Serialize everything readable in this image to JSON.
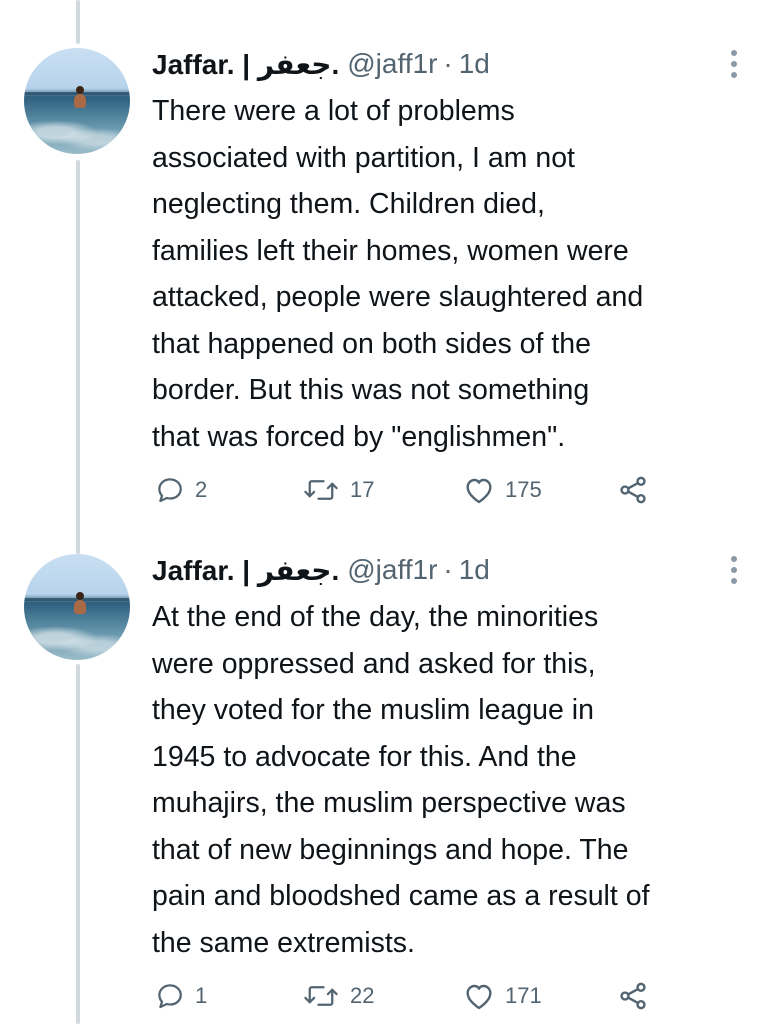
{
  "tweets": [
    {
      "author_name": "Jaffar. | جعفر.",
      "handle": "@jaff1r",
      "separator": "·",
      "time": "1d",
      "text": "There were a lot of problems\nassociated with partition, I am not\nneglecting them. Children died,\nfamilies left their homes, women were\nattacked, people were slaughtered and\nthat happened on both sides of the\nborder. But this was not something\nthat was forced by \"englishmen\".",
      "replies": "2",
      "retweets": "17",
      "likes": "175"
    },
    {
      "author_name": "Jaffar. | جعفر.",
      "handle": "@jaff1r",
      "separator": "·",
      "time": "1d",
      "text": "At the end of the day, the minorities\nwere oppressed and asked for this,\nthey voted for the muslim league in\n1945 to advocate for this. And the\nmuhajirs, the muslim perspective was\nthat of new beginnings and hope. The\npain and bloodshed came as a result of\nthe same extremists.",
      "replies": "1",
      "retweets": "22",
      "likes": "171"
    }
  ],
  "colors": {
    "text_primary": "#0f1419",
    "text_secondary": "#536471",
    "thread_line": "#cfd9de",
    "icon": "#536471"
  },
  "icons": {
    "reply": "speech-bubble",
    "retweet": "retweet-arrows",
    "like": "heart-outline",
    "share": "share-nodes",
    "more": "vertical-ellipsis"
  }
}
